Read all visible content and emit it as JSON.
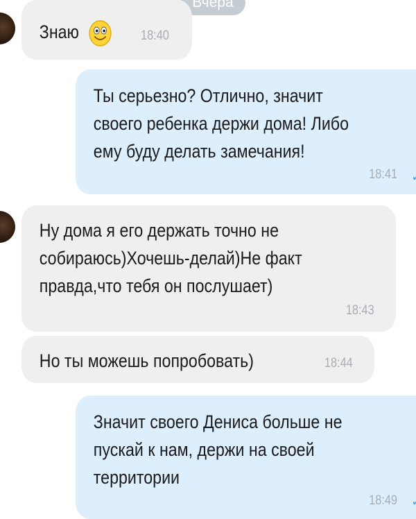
{
  "chat": {
    "date_label": "Вчера",
    "messages": [
      {
        "direction": "incoming",
        "text": "Знаю",
        "emoji": "smiling-face-icon",
        "time": "18:40"
      },
      {
        "direction": "outgoing",
        "text": "Ты серьезно? Отлично, значит\nсвоего ребенка держи дома! Либо\nему буду делать замечания!",
        "time": "18:41"
      },
      {
        "direction": "incoming",
        "text": "Ну дома я его держать точно не\nсобираюсь)Хочешь-делай)Не факт\nправда,что тебя он послушает)",
        "time": "18:43"
      },
      {
        "direction": "incoming",
        "text": "Но ты можешь попробовать)",
        "time": "18:44"
      },
      {
        "direction": "outgoing",
        "text": "Значит своего Дениса больше не\nпускай к нам, держи на своей\nтерритории",
        "time": "18:49"
      }
    ]
  },
  "colors": {
    "incoming_bubble": "#efefef",
    "outgoing_bubble": "#ddeefc",
    "time_text": "#a9aeb3",
    "date_chip": "#c5ccd2",
    "read_tick": "#4ea3e0"
  }
}
